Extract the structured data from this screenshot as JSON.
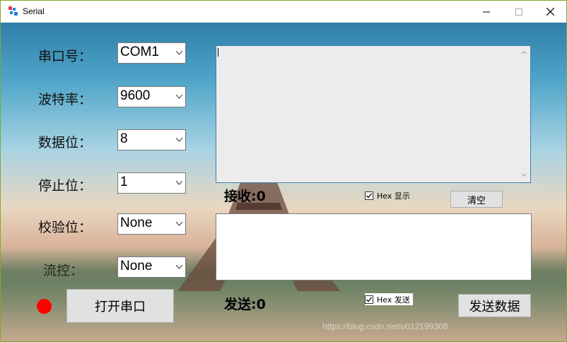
{
  "window": {
    "title": "Serial"
  },
  "settings": {
    "port": {
      "label": "串口号：",
      "value": "COM1"
    },
    "baud": {
      "label": "波特率：",
      "value": "9600"
    },
    "databits": {
      "label": "数据位：",
      "value": "8"
    },
    "stopbits": {
      "label": "停止位：",
      "value": "1"
    },
    "parity": {
      "label": "校验位：",
      "value": "None"
    },
    "flow": {
      "label": "流控：",
      "value": "None"
    }
  },
  "receive": {
    "counter": "接收:0",
    "hex_label": "Hex 显示",
    "hex_checked": true,
    "clear_label": "清空"
  },
  "send": {
    "counter": "发送:0",
    "hex_label": "Hex 发送",
    "hex_checked": true,
    "send_label": "发送数据"
  },
  "open_button": {
    "label": "打开串口"
  },
  "status": {
    "led_color": "#ff0000"
  },
  "watermark": "https://blog.csdn.net/u012199308"
}
